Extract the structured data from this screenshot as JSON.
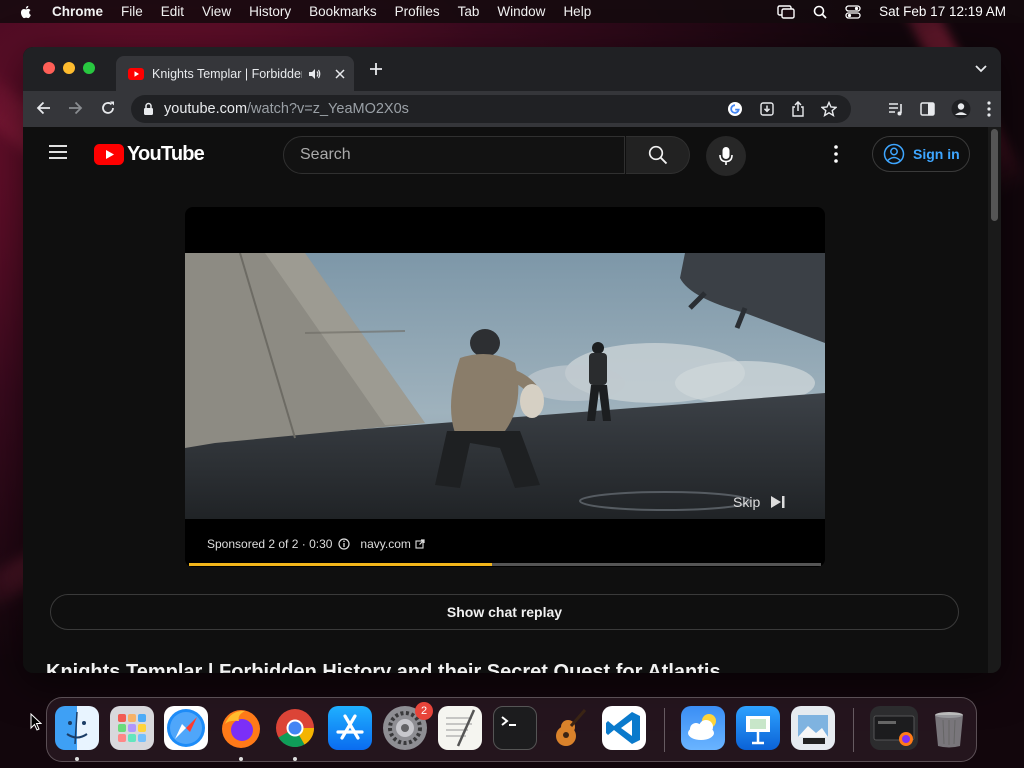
{
  "menubar": {
    "app_name": "Chrome",
    "items": [
      "File",
      "Edit",
      "View",
      "History",
      "Bookmarks",
      "Profiles",
      "Tab",
      "Window",
      "Help"
    ],
    "clock": "Sat Feb 17  12:19 AM"
  },
  "browser": {
    "tab_title": "Knights Templar | Forbidden History and their Secret Quest for Atlantis",
    "url_host": "youtube.com",
    "url_path": "/watch?v=z_YeaMO2X0s"
  },
  "youtube": {
    "logo_text": "YouTube",
    "search_placeholder": "Search",
    "sign_in_label": "Sign in",
    "ad": {
      "skip_label": "Skip",
      "sponsored_text": "Sponsored 2 of 2 · 0:30",
      "advertiser": "navy.com",
      "progress_fraction": 0.48
    },
    "chat_replay_label": "Show chat replay",
    "video_title": "Knights Templar | Forbidden History and their Secret Quest for Atlantis"
  },
  "dock": {
    "apps": [
      {
        "name": "Finder",
        "icon": "finder-icon",
        "running": true
      },
      {
        "name": "Launchpad",
        "icon": "launchpad-icon",
        "running": false
      },
      {
        "name": "Safari",
        "icon": "safari-icon",
        "running": false
      },
      {
        "name": "Firefox",
        "icon": "firefox-icon",
        "running": true
      },
      {
        "name": "Google Chrome",
        "icon": "chrome-icon",
        "running": true
      },
      {
        "name": "App Store",
        "icon": "app-store-icon",
        "running": false
      },
      {
        "name": "System Settings",
        "icon": "settings-icon",
        "running": false,
        "badge": "2"
      },
      {
        "name": "TextEdit",
        "icon": "textedit-icon",
        "running": false
      },
      {
        "name": "Terminal",
        "icon": "terminal-icon",
        "running": false
      },
      {
        "name": "GarageBand",
        "icon": "garageband-icon",
        "running": false
      },
      {
        "name": "Visual Studio Code",
        "icon": "vscode-icon",
        "running": false
      },
      {
        "name": "Weather",
        "icon": "weather-icon",
        "running": false
      },
      {
        "name": "Keynote",
        "icon": "keynote-icon",
        "running": false
      },
      {
        "name": "Preview",
        "icon": "preview-icon",
        "running": false
      },
      {
        "name": "Downloads",
        "icon": "downloads-stack-icon",
        "running": false
      },
      {
        "name": "Trash",
        "icon": "trash-icon",
        "running": false
      }
    ]
  },
  "colors": {
    "youtube_red": "#ff0000",
    "link_blue": "#3ea6ff",
    "ad_progress": "#f2b51a",
    "chrome_toolbar": "#35363a"
  }
}
